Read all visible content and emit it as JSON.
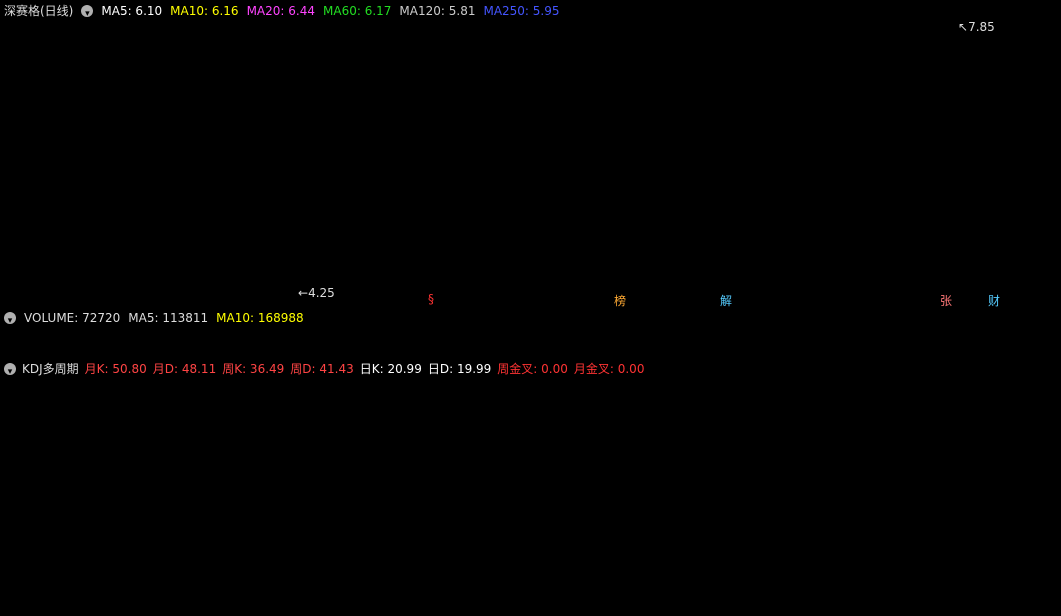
{
  "main_panel": {
    "title": "深赛格(日线)",
    "indicators": [
      {
        "label": "MA5: 6.10",
        "color": "#ffffff"
      },
      {
        "label": "MA10: 6.16",
        "color": "#ffff00"
      },
      {
        "label": "MA20: 6.44",
        "color": "#ff44ff"
      },
      {
        "label": "MA60: 6.17",
        "color": "#22dd22"
      },
      {
        "label": "MA120: 5.81",
        "color": "#cccccc"
      },
      {
        "label": "MA250: 5.95",
        "color": "#4455ff"
      }
    ],
    "high_label": "7.85",
    "low_label": "4.25",
    "event_tags": [
      {
        "text": "§",
        "color": "#ff3333"
      },
      {
        "text": "榜",
        "color": "#ffaa33"
      },
      {
        "text": "解",
        "color": "#55ccff"
      },
      {
        "text": "张",
        "color": "#ff7777"
      },
      {
        "text": "财",
        "color": "#55ccff"
      }
    ]
  },
  "volume_panel": {
    "items": [
      {
        "label": "VOLUME: 72720",
        "color": "#dddddd"
      },
      {
        "label": "MA5: 113811",
        "color": "#dddddd"
      },
      {
        "label": "MA10: 168988",
        "color": "#ffff00"
      }
    ]
  },
  "kdj_panel": {
    "items": [
      {
        "label": "KDJ多周期",
        "color": "#dddddd"
      },
      {
        "label": "月K: 50.80",
        "color": "#ff4444"
      },
      {
        "label": "月D: 48.11",
        "color": "#ff4444"
      },
      {
        "label": "周K: 36.49",
        "color": "#ff4444"
      },
      {
        "label": "周D: 41.43",
        "color": "#ff4444"
      },
      {
        "label": "日K: 20.99",
        "color": "#ffffff"
      },
      {
        "label": "日D: 19.99",
        "color": "#ffffff"
      },
      {
        "label": "周金叉: 0.00",
        "color": "#ff3333"
      },
      {
        "label": "月金叉: 0.00",
        "color": "#ff3333"
      }
    ]
  },
  "colors": {
    "up": "#ff3333",
    "down": "#54ffff",
    "grid": "#7a0000",
    "border": "#a00000"
  }
}
